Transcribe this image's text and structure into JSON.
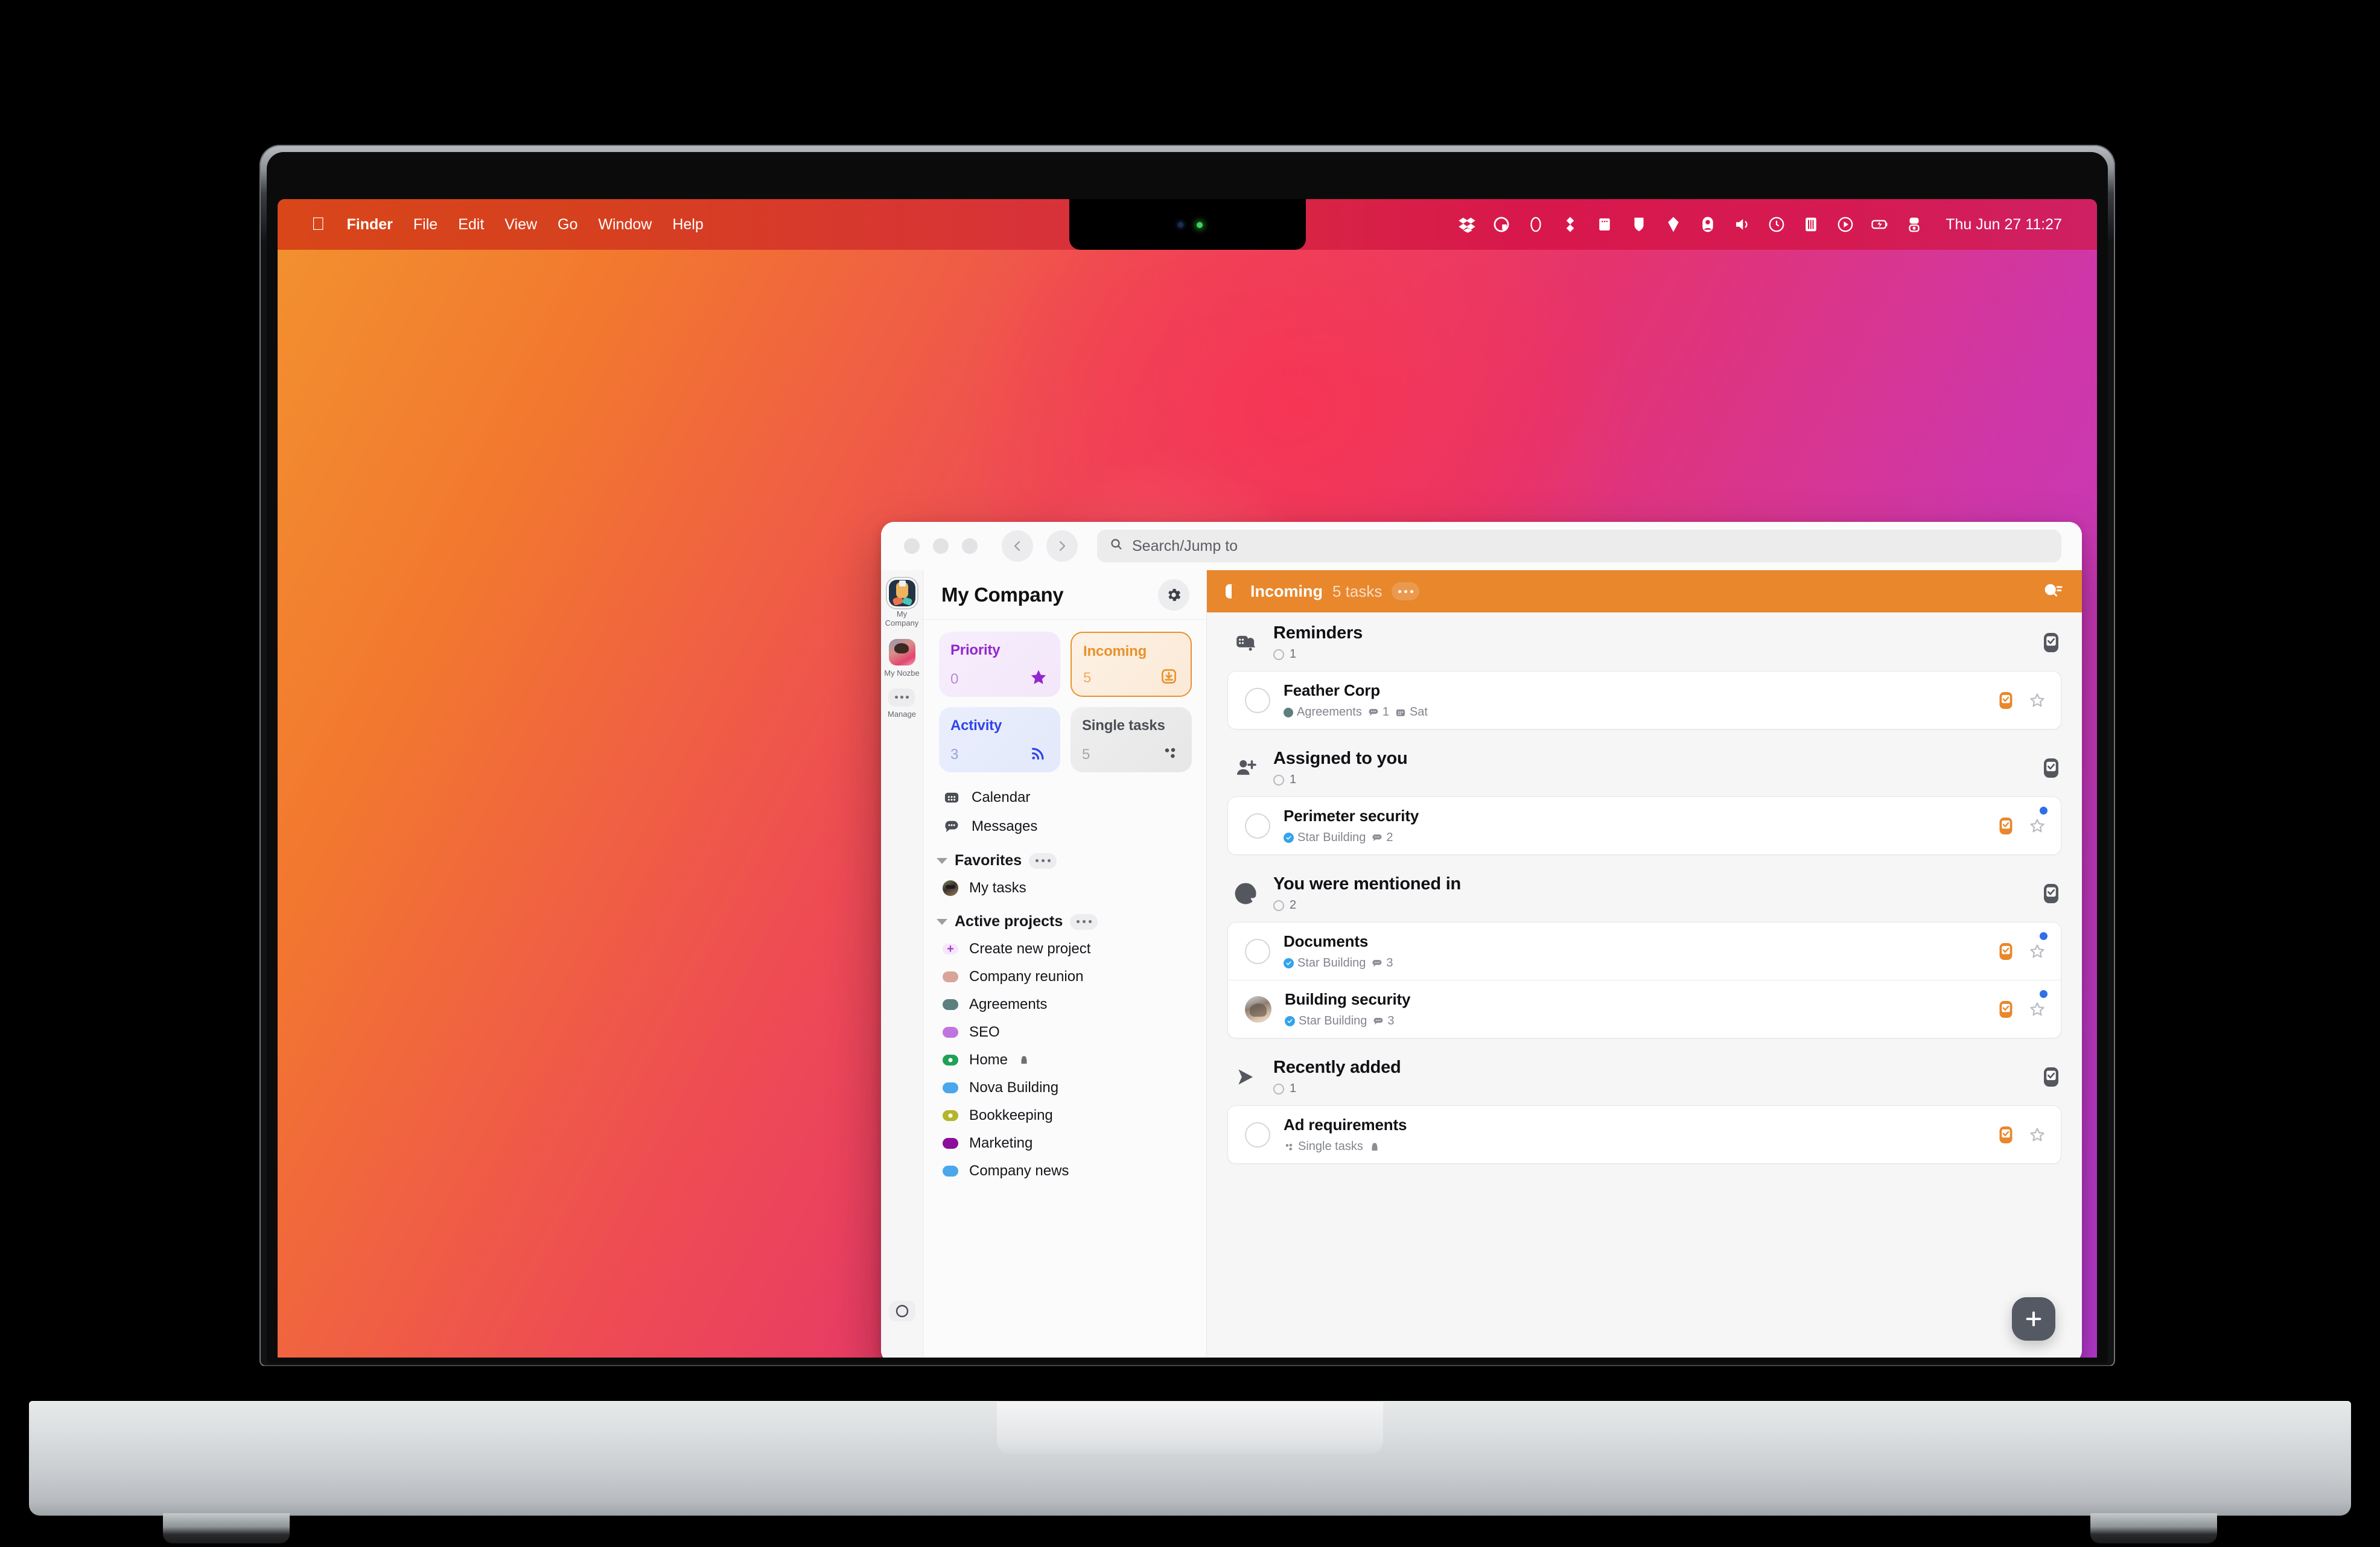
{
  "menubar": {
    "apple_glyph": "apple-logo",
    "items": [
      "Finder",
      "File",
      "Edit",
      "View",
      "Go",
      "Window",
      "Help"
    ],
    "status_icons": [
      "dropbox-icon",
      "lock-circle-icon",
      "circle-icon",
      "cloud-sync-icon",
      "memory-icon",
      "drive-icon",
      "diamond-icon",
      "account-icon",
      "volume-icon",
      "time-machine-icon",
      "battery-bars-icon",
      "play-circle-icon",
      "battery-charging-icon",
      "control-center-icon"
    ],
    "clock": "Thu Jun 27  11:27"
  },
  "window": {
    "nav_back": "‹",
    "nav_forward": "›",
    "search": {
      "placeholder": "Search/Jump to",
      "icon": "search-icon"
    }
  },
  "rail": {
    "workspaces": [
      {
        "label": "My Company",
        "selected": true,
        "avatar": "company-handshake-avatar"
      },
      {
        "label": "My Nozbe",
        "selected": false,
        "avatar": "nozbe-portrait-avatar"
      }
    ],
    "manage": {
      "label": "Manage",
      "icon": "ellipsis-icon"
    },
    "bottom_icon": "nozbe-logo-icon"
  },
  "sidebar": {
    "title": "My Company",
    "gear_icon": "gear-icon",
    "tiles": [
      {
        "name": "Priority",
        "count": "0",
        "icon": "star-icon",
        "variant": "priority",
        "selected": false
      },
      {
        "name": "Incoming",
        "count": "5",
        "icon": "inbox-download-icon",
        "variant": "incoming",
        "selected": true
      },
      {
        "name": "Activity",
        "count": "3",
        "icon": "rss-icon",
        "variant": "activity",
        "selected": false
      },
      {
        "name": "Single tasks",
        "count": "5",
        "icon": "dots-cluster-icon",
        "variant": "single",
        "selected": false
      }
    ],
    "links": [
      {
        "label": "Calendar",
        "icon": "calendar-icon"
      },
      {
        "label": "Messages",
        "icon": "messages-icon"
      }
    ],
    "favorites": {
      "label": "Favorites",
      "more_icon": "ellipsis-icon",
      "items": [
        {
          "label": "My tasks",
          "icon": "user-avatar"
        }
      ]
    },
    "active_projects": {
      "label": "Active projects",
      "more_icon": "ellipsis-icon",
      "create": {
        "label": "Create new project",
        "icon": "plus-icon"
      },
      "items": [
        {
          "label": "Company reunion",
          "color": "#d9a59b",
          "ring": false,
          "locked": false
        },
        {
          "label": "Agreements",
          "color": "#5c7f80",
          "ring": false,
          "locked": false
        },
        {
          "label": "SEO",
          "color": "#c173e0",
          "ring": false,
          "locked": false
        },
        {
          "label": "Home",
          "color": "#21a155",
          "ring": true,
          "locked": true
        },
        {
          "label": "Nova Building",
          "color": "#4aa7ec",
          "ring": false,
          "locked": false
        },
        {
          "label": "Bookkeeping",
          "color": "#b5b52c",
          "ring": true,
          "locked": false
        },
        {
          "label": "Marketing",
          "color": "#8a0f9a",
          "ring": false,
          "locked": false
        },
        {
          "label": "Company news",
          "color": "#4aa7ec",
          "ring": false,
          "locked": false
        }
      ]
    }
  },
  "main": {
    "header": {
      "icon": "incoming-panel-icon",
      "title": "Incoming",
      "count": "5 tasks",
      "more_icon": "ellipsis-icon",
      "filter_icon": "search-filter-icon",
      "bg_color": "#e8872c"
    },
    "groups": [
      {
        "name": "Reminders",
        "count": "1",
        "icon": "reminder-bell-icon",
        "check_icon": "checkbox-icon",
        "tasks": [
          {
            "name": "Feather Corp",
            "avatar": null,
            "project": "Agreements",
            "project_color": "#5c7f80",
            "project_verified": false,
            "comments": "1",
            "date": "Sat",
            "unread": false,
            "complete_icon": "check-orange-icon",
            "star_icon": "star-outline-icon"
          }
        ]
      },
      {
        "name": "Assigned to you",
        "count": "1",
        "icon": "person-add-icon",
        "check_icon": "checkbox-icon",
        "tasks": [
          {
            "name": "Perimeter security",
            "avatar": null,
            "project": "Star Building",
            "project_color": "#35a3ec",
            "project_verified": true,
            "comments": "2",
            "date": null,
            "unread": true,
            "complete_icon": "check-orange-icon",
            "star_icon": "star-outline-icon"
          }
        ]
      },
      {
        "name": "You were mentioned in",
        "count": "2",
        "icon": "at-sign-icon",
        "check_icon": "checkbox-icon",
        "tasks": [
          {
            "name": "Documents",
            "avatar": null,
            "project": "Star Building",
            "project_color": "#35a3ec",
            "project_verified": true,
            "comments": "3",
            "date": null,
            "unread": true,
            "complete_icon": "check-orange-icon",
            "star_icon": "star-outline-icon"
          },
          {
            "name": "Building security",
            "avatar": "person-avatar",
            "project": "Star Building",
            "project_color": "#35a3ec",
            "project_verified": true,
            "comments": "3",
            "date": null,
            "unread": true,
            "complete_icon": "check-orange-icon",
            "star_icon": "star-outline-icon"
          }
        ]
      },
      {
        "name": "Recently added",
        "count": "1",
        "icon": "send-arrow-icon",
        "check_icon": "checkbox-icon",
        "tasks": [
          {
            "name": "Ad requirements",
            "avatar": null,
            "project": "Single tasks",
            "project_color": null,
            "project_verified": false,
            "project_icon": "dots-cluster-icon",
            "comments": null,
            "date": null,
            "locked": true,
            "unread": false,
            "complete_icon": "check-orange-icon",
            "star_icon": "star-outline-icon"
          }
        ]
      }
    ],
    "fab": {
      "label": "+",
      "icon": "plus-icon"
    }
  }
}
